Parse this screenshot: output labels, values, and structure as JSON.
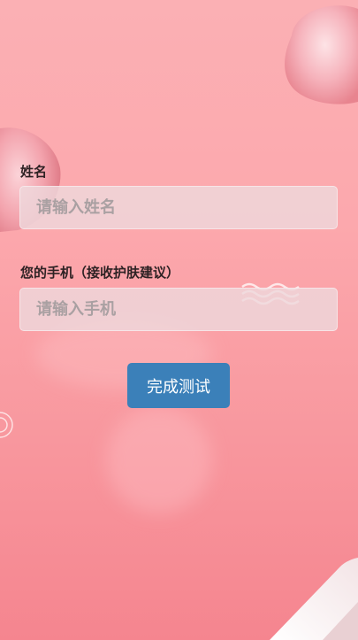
{
  "form": {
    "name_label": "姓名",
    "name_placeholder": "请输入姓名",
    "phone_label": "您的手机（接收护肤建议）",
    "phone_placeholder": "请输入手机",
    "submit_label": "完成测试"
  },
  "colors": {
    "background_top": "#fbb0b4",
    "background_bottom": "#f5858f",
    "button": "#3b80b9",
    "input_background": "#eed8dc"
  },
  "decorations": [
    "rose-petal-icon",
    "wave-icon",
    "spiral-icon",
    "ribbon-icon"
  ]
}
